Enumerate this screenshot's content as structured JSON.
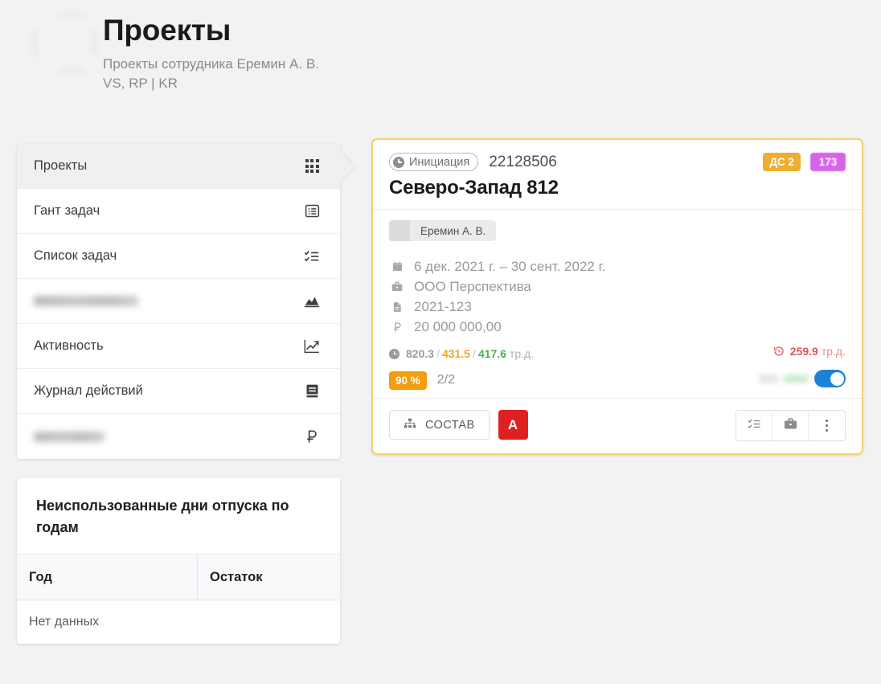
{
  "header": {
    "title": "Проекты",
    "subtitle": "Проекты сотрудника Еремин А. В.\nVS, RP | KR"
  },
  "sidebar": {
    "items": [
      {
        "label": "Проекты",
        "icon": "grid-icon",
        "active": true,
        "redacted": false
      },
      {
        "label": "Гант задач",
        "icon": "gantt-icon",
        "active": false,
        "redacted": false
      },
      {
        "label": "Список задач",
        "icon": "checklist-icon",
        "active": false,
        "redacted": false
      },
      {
        "label": "",
        "icon": "chart-area-icon",
        "active": false,
        "redacted": true
      },
      {
        "label": "Активность",
        "icon": "trending-up-icon",
        "active": false,
        "redacted": false
      },
      {
        "label": "Журнал действий",
        "icon": "journal-icon",
        "active": false,
        "redacted": false
      },
      {
        "label": "",
        "icon": "ruble-icon",
        "active": false,
        "redacted": true
      }
    ]
  },
  "vacation": {
    "title": "Неиспользованные дни отпуска по годам",
    "columns": [
      "Год",
      "Остаток"
    ],
    "empty_text": "Нет данных"
  },
  "project": {
    "status_label": "Инициация",
    "code": "22128506",
    "name": "Северо-Запад 812",
    "badges": [
      {
        "label": "ДС 2",
        "color": "#f0ad2e"
      },
      {
        "label": "173",
        "color": "#d564e8"
      }
    ],
    "person": "Еремин А. В.",
    "meta": [
      {
        "icon": "calendar-icon",
        "value": "6 дек. 2021 г. – 30 сент. 2022 г."
      },
      {
        "icon": "briefcase-icon",
        "value": "ООО Перспектива"
      },
      {
        "icon": "document-icon",
        "value": "2021-123"
      },
      {
        "icon": "ruble-icon",
        "value": "20 000 000,00"
      }
    ],
    "hours": {
      "total": "820.3",
      "separator": "/",
      "plan": "431.5",
      "fact": "417.6",
      "unit": "тр.д.",
      "total_color": "#9a9a9a",
      "plan_color": "#f0a824",
      "fact_color": "#4caf50"
    },
    "overdue": {
      "value": "259.9",
      "unit": "тр.д.",
      "color": "#e8505b"
    },
    "progress": {
      "percent_label": "90 %",
      "percent_color": "#f59c11",
      "task_count": "2/2"
    },
    "toggle": {
      "state": "on",
      "color": "#1c81da"
    },
    "footer": {
      "compose_label": "СОСТАВ",
      "letter_label": "A",
      "letter_color": "#e02020",
      "actions": [
        "checklist-icon",
        "briefcase-icon",
        "kebab-menu-icon"
      ]
    }
  }
}
